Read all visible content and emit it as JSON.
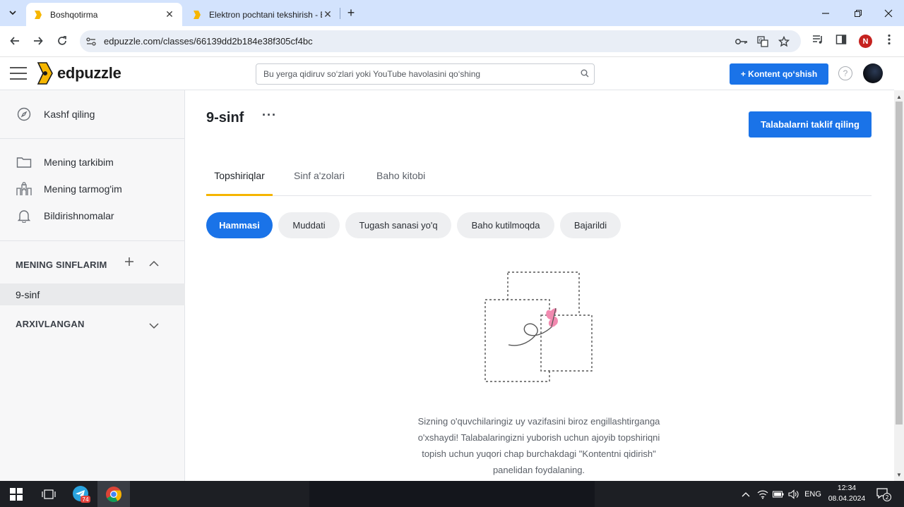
{
  "browser": {
    "tabs": [
      {
        "title": "Boshqotirma",
        "active": true
      },
      {
        "title": "Elektron pochtani tekshirish - Ed",
        "active": false
      }
    ],
    "url": "edpuzzle.com/classes/66139dd2b184e38f305cf4bc",
    "profile_initial": "N"
  },
  "header": {
    "logo_text": "edpuzzle",
    "search_placeholder": "Bu yerga qidiruv so‘zlari yoki YouTube havolasini qo‘shing",
    "add_content_label": "+ Kontent qo‘shish",
    "help_label": "?"
  },
  "sidebar": {
    "discover": "Kashf qiling",
    "items": [
      {
        "label": "Mening tarkibim",
        "icon": "folder-icon"
      },
      {
        "label": "Mening tarmog'im",
        "icon": "network-icon"
      },
      {
        "label": "Bildirishnomalar",
        "icon": "bell-icon"
      }
    ],
    "my_classes_title": "MENING SINFLARIM",
    "classes": [
      "9-sinf"
    ],
    "archived_title": "ARXIVLANGAN"
  },
  "main": {
    "class_title": "9-sinf",
    "more_label": "···",
    "invite_label": "Talabalarni taklif qiling",
    "tabs": [
      "Topshiriqlar",
      "Sinf a'zolari",
      "Baho kitobi"
    ],
    "filters": [
      "Hammasi",
      "Muddati",
      "Tugash sanasi yo'q",
      "Baho kutilmoqda",
      "Bajarildi"
    ],
    "empty_lines": [
      "Sizning o'quvchilaringiz uy vazifasini biroz engillashtirganga",
      "o'xshaydi! Talabalaringizni yuborish uchun ajoyib topshiriqni",
      "topish uchun yuqori chap burchakdagi \"Kontentni qidirish\"",
      "panelidan foydalaning."
    ]
  },
  "taskbar": {
    "telegram_badge": "74",
    "language": "ENG",
    "time": "12:34",
    "date": "08.04.2024",
    "notification_count": "2"
  },
  "colors": {
    "accent": "#1a73e8",
    "tab_underline": "#f5b400",
    "logo_yellow": "#f6b600"
  }
}
